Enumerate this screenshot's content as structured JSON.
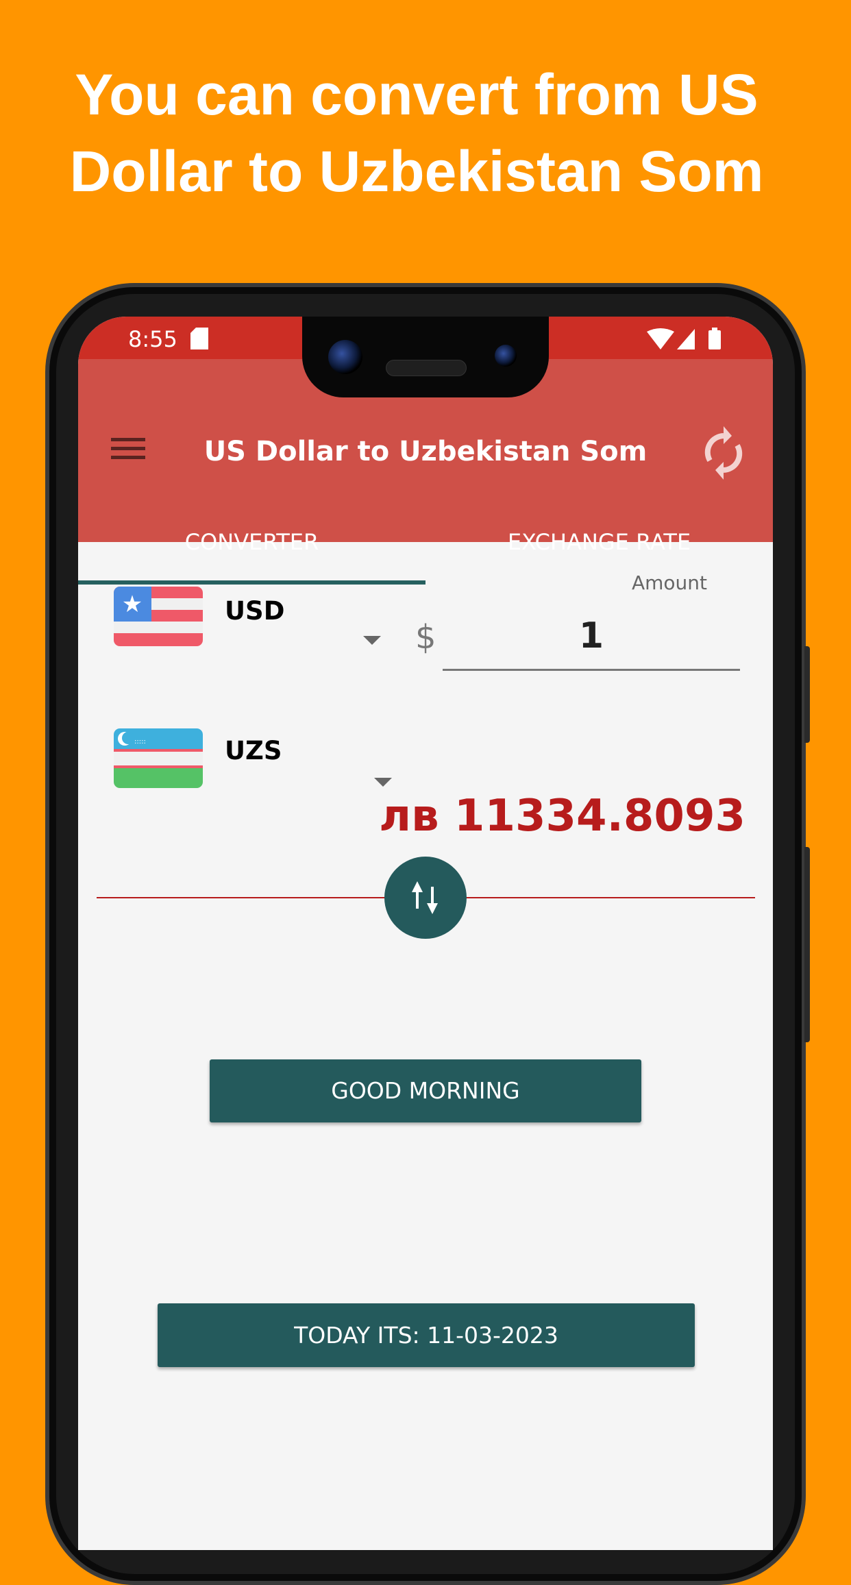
{
  "headline": {
    "line1": "You can convert from US",
    "line2": "Dollar to Uzbekistan Som"
  },
  "status_bar": {
    "time": "8:55",
    "icons": [
      "sd-card-icon",
      "wifi-icon",
      "signal-icon",
      "battery-icon"
    ]
  },
  "app_bar": {
    "title": "US Dollar to Uzbekistan Som",
    "menu_icon": "hamburger-icon",
    "refresh_icon": "refresh-icon"
  },
  "tabs": [
    {
      "label": "CONVERTER",
      "active": true
    },
    {
      "label": "EXCHANGE RATE",
      "active": false
    }
  ],
  "converter": {
    "from": {
      "code": "USD",
      "flag": "us-flag"
    },
    "to": {
      "code": "UZS",
      "flag": "uz-flag"
    },
    "amount_label": "Amount",
    "currency_symbol": "$",
    "amount_value": "1",
    "result": "лв 11334.8093"
  },
  "buttons": {
    "greeting": "GOOD MORNING",
    "date": "TODAY ITS: 11-03-2023"
  },
  "colors": {
    "background": "#ff9500",
    "status_bar": "#cc2e25",
    "app_bar": "#cf5048",
    "accent": "#245a5c",
    "result": "#b71c1c"
  }
}
